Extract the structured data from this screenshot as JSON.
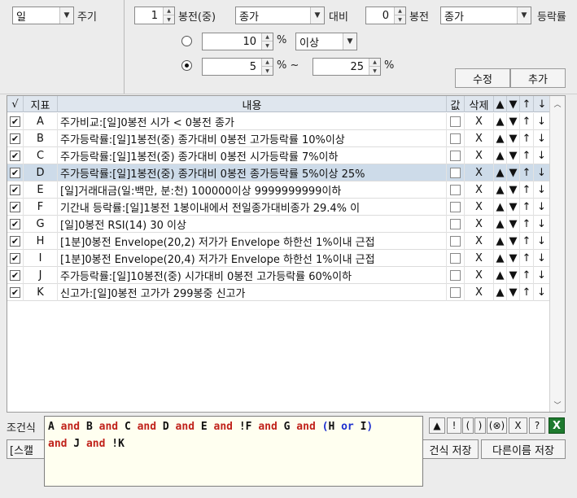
{
  "top": {
    "period_value": "일",
    "period_label": "주기",
    "left_offset": "1",
    "left_offset_label": "봉전(중)",
    "left_field": "종가",
    "compare_label": "대비",
    "right_offset": "0",
    "right_offset_label": "봉전",
    "right_field": "종가",
    "rate_label": "등락률",
    "r1_value": "10",
    "r1_unit": "%",
    "r1_cond": "이상",
    "r2_from": "5",
    "r2_unit": "% ~",
    "r2_to": "25",
    "r2_unit2": "%",
    "edit_label": "수정",
    "add_label": "추가"
  },
  "table": {
    "headers": {
      "check": "√",
      "id": "지표",
      "content": "내용",
      "value": "값",
      "delete": "삭제"
    },
    "rows": [
      {
        "checked": true,
        "id": "A",
        "content": "주가비교:[일]0봉전 시가 < 0봉전 종가",
        "del": "X"
      },
      {
        "checked": true,
        "id": "B",
        "content": "주가등락률:[일]1봉전(중) 종가대비 0봉전 고가등락률 10%이상",
        "del": "X"
      },
      {
        "checked": true,
        "id": "C",
        "content": "주가등락률:[일]1봉전(중) 종가대비 0봉전 시가등락률 7%이하",
        "del": "X"
      },
      {
        "checked": true,
        "id": "D",
        "content": "주가등락률:[일]1봉전(중) 종가대비 0봉전 종가등락률 5%이상 25%",
        "del": "X",
        "selected": true
      },
      {
        "checked": true,
        "id": "E",
        "content": "[일]거래대금(일:백만, 분:천) 100000이상 9999999999이하",
        "del": "X"
      },
      {
        "checked": true,
        "id": "F",
        "content": "기간내 등락률:[일]1봉전 1봉이내에서 전일종가대비종가 29.4% 이",
        "del": "X"
      },
      {
        "checked": true,
        "id": "G",
        "content": "[일]0봉전 RSI(14) 30 이상",
        "del": "X"
      },
      {
        "checked": true,
        "id": "H",
        "content": "[1분]0봉전 Envelope(20,2) 저가가 Envelope 하한선 1%이내 근접",
        "del": "X"
      },
      {
        "checked": true,
        "id": "I",
        "content": "[1분]0봉전 Envelope(20,4) 저가가 Envelope 하한선 1%이내 근접",
        "del": "X"
      },
      {
        "checked": true,
        "id": "J",
        "content": "주가등락률:[일]10봉전(중) 시가대비 0봉전 고가등락률 60%이하",
        "del": "X"
      },
      {
        "checked": true,
        "id": "K",
        "content": "신고가:[일]0봉전 고가가 299봉중 신고가",
        "del": "X"
      }
    ]
  },
  "bottom": {
    "formula_label": "조건식",
    "scan_label": "[스캘",
    "formula_line1": [
      "A",
      " and ",
      "B",
      " and ",
      "C",
      " and ",
      "D",
      " and ",
      "E",
      " and ",
      "!F",
      " and ",
      "G",
      " and ",
      "(H",
      " or ",
      "I)"
    ],
    "formula_line2": [
      "and",
      " J",
      " and ",
      "!K"
    ],
    "toolbar": [
      "▲",
      "!",
      "(",
      ")",
      "(⊗)",
      "X",
      "?"
    ],
    "save_label": "건식 저장",
    "save_as_label": "다른이름 저장"
  }
}
